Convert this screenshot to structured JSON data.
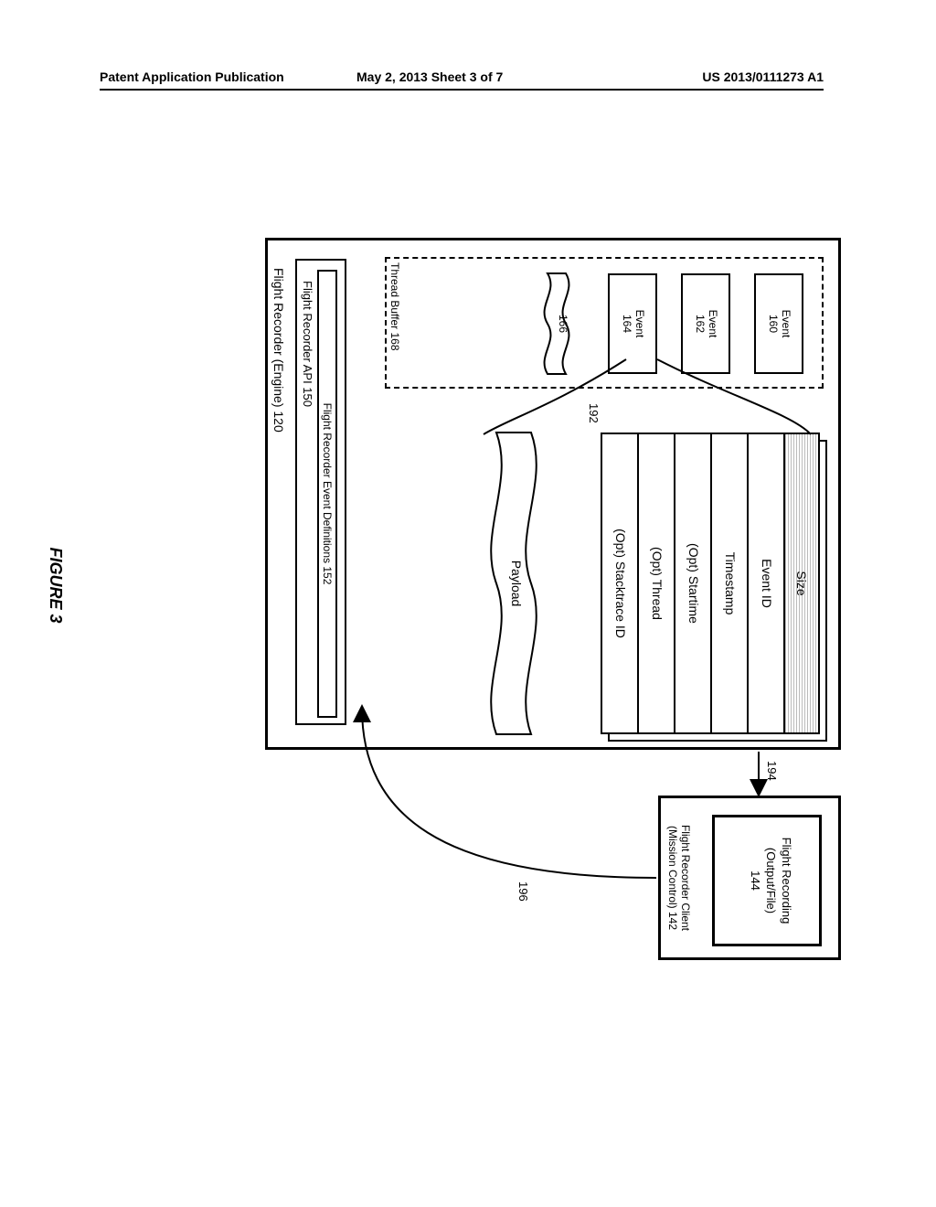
{
  "header": {
    "left": "Patent Application Publication",
    "center": "May 2, 2013  Sheet 3 of 7",
    "right": "US 2013/0111273 A1"
  },
  "engine": {
    "label": "Flight Recorder (Engine) 120",
    "api_label": "Flight Recorder API 150",
    "defs_label": "Flight Recorder Event Definitions 152"
  },
  "thread_buffer": {
    "label": "Thread Buffer 168",
    "events": [
      {
        "label": "Event\n160"
      },
      {
        "label": "Event\n162"
      },
      {
        "label": "Event\n164"
      },
      {
        "continuation_ref": "166"
      }
    ]
  },
  "event_fields": {
    "ref": "192",
    "rows": [
      "Size",
      "Event ID",
      "Timestamp",
      "(Opt) Startime",
      "(Opt) Thread",
      "(Opt) Stacktrace ID"
    ],
    "payload": "Payload"
  },
  "client": {
    "label": "Flight Recorder Client\n(Mission Control) 142",
    "recording_label": "Flight Recording\n(Output/File)\n144"
  },
  "arrows": {
    "out": "194",
    "in": "196"
  },
  "figure_caption": "FIGURE 3"
}
